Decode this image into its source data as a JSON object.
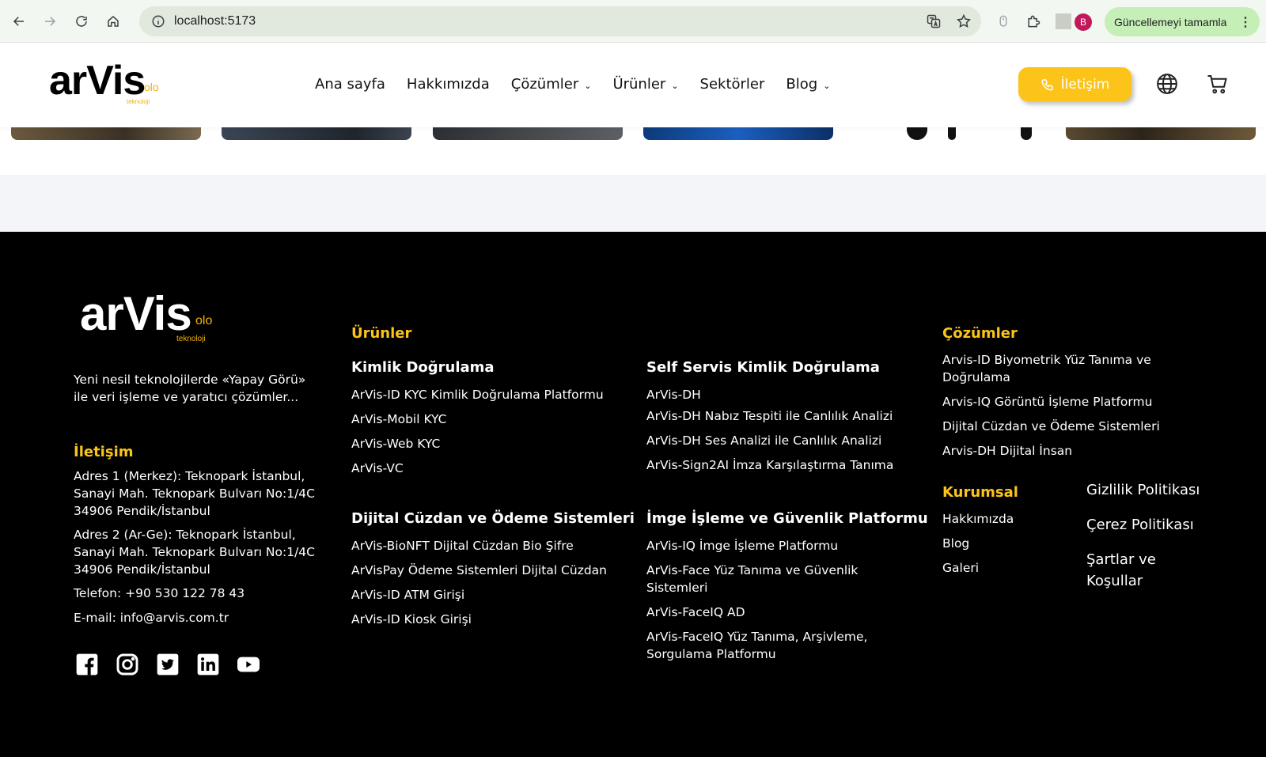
{
  "browser": {
    "url": "localhost:5173",
    "profile_initial": "B",
    "update_label": "Güncellemeyi tamamla"
  },
  "header": {
    "logo": {
      "word": "arVis",
      "olo": "olo",
      "tagline": "teknoloji"
    },
    "nav": [
      {
        "label": "Ana sayfa",
        "has_dropdown": false
      },
      {
        "label": "Hakkımızda",
        "has_dropdown": false
      },
      {
        "label": "Çözümler",
        "has_dropdown": true
      },
      {
        "label": "Ürünler",
        "has_dropdown": true
      },
      {
        "label": "Sektörler",
        "has_dropdown": false
      },
      {
        "label": "Blog",
        "has_dropdown": true
      }
    ],
    "cta_label": "İletişim",
    "accent": "#fcc419"
  },
  "footer": {
    "logo": {
      "word": "arVis",
      "olo": "olo",
      "tagline": "teknoloji"
    },
    "tagline": "Yeni nesil teknolojilerde «Yapay Görü» ile veri işleme ve yaratıcı çözümler...",
    "contact": {
      "title": "İletişim",
      "address1": "Adres 1 (Merkez): Teknopark İstanbul, Sanayi Mah. Teknopark Bulvarı No:1/4C 34906 Pendik/İstanbul",
      "address2": "Adres 2 (Ar-Ge): Teknopark İstanbul, Sanayi Mah. Teknopark Bulvarı No:1/4C 34906 Pendik/İstanbul",
      "phone": "Telefon: +90 530 122 78 43",
      "email": "E-mail: info@arvis.com.tr"
    },
    "products": {
      "title": "Ürünler",
      "groups": [
        {
          "title": "Kimlik Doğrulama",
          "items": [
            "ArVis-ID KYC Kimlik Doğrulama Platformu",
            "ArVis-Mobil KYC",
            "ArVis-Web KYC",
            "ArVis-VC"
          ]
        },
        {
          "title": "Self Servis Kimlik Doğrulama",
          "items": [
            "ArVis-DH",
            "ArVis-DH Nabız Tespiti ile Canlılık Analizi",
            "ArVis-DH Ses Analizi ile Canlılık Analizi",
            "ArVis-Sign2AI İmza Karşılaştırma Tanıma"
          ]
        },
        {
          "title": "Dijital Cüzdan ve Ödeme Sistemleri",
          "items": [
            "ArVis-BioNFT Dijital Cüzdan Bio Şifre",
            "ArVisPay Ödeme Sistemleri Dijital Cüzdan",
            "ArVis-ID ATM Girişi",
            "ArVis-ID Kiosk Girişi"
          ]
        },
        {
          "title": "İmge İşleme ve Güvenlik Platformu",
          "items": [
            "ArVis-IQ İmge İşleme Platformu",
            "ArVis-Face Yüz Tanıma ve Güvenlik Sistemleri",
            "ArVis-FaceIQ AD",
            "ArVis-FaceIQ Yüz Tanıma, Arşivleme, Sorgulama Platformu"
          ]
        }
      ]
    },
    "solutions": {
      "title": "Çözümler",
      "items": [
        "Arvis-ID Biyometrik Yüz Tanıma ve Doğrulama",
        "Arvis-IQ Görüntü İşleme Platformu",
        "Dijital Cüzdan ve Ödeme Sistemleri",
        "Arvis-DH Dijital İnsan"
      ]
    },
    "corporate": {
      "title": "Kurumsal",
      "items": [
        "Hakkımızda",
        "Blog",
        "Galeri"
      ]
    },
    "legal": [
      "Gizlilik Politikası",
      "Çerez Politikası",
      "Şartlar ve Koşullar"
    ],
    "socials": [
      "facebook-icon",
      "instagram-icon",
      "twitter-icon",
      "linkedin-icon",
      "youtube-icon"
    ]
  }
}
